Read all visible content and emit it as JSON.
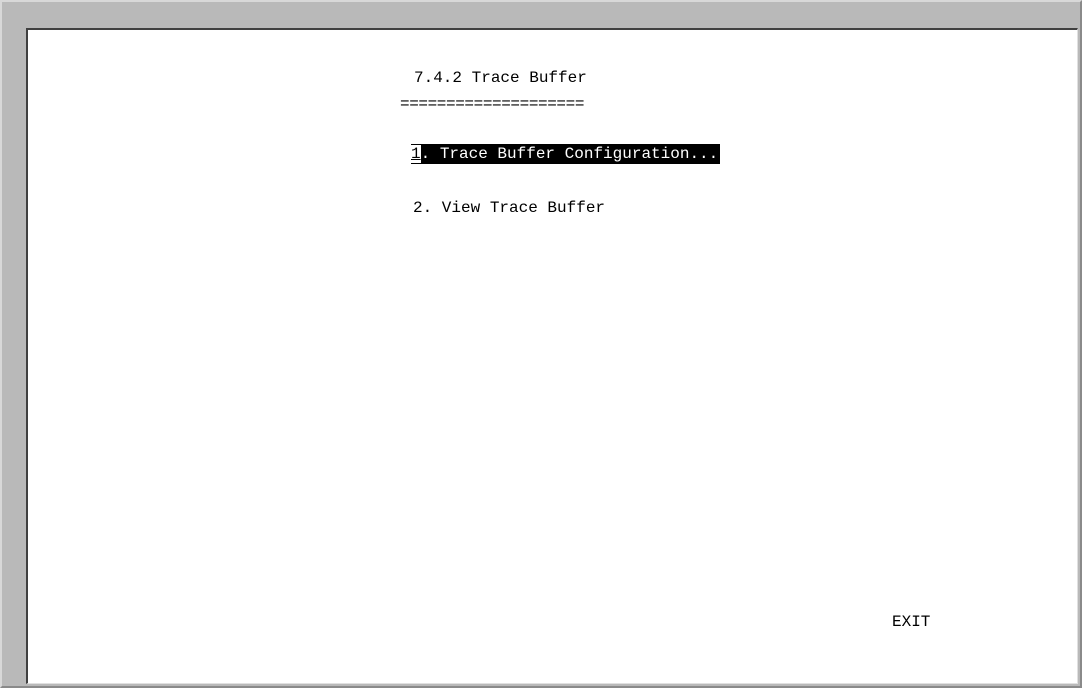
{
  "screen": {
    "title": "7.4.2 Trace Buffer",
    "title_underline": "====================",
    "menu": [
      {
        "key": "1",
        "label": ". Trace Buffer Configuration..."
      },
      {
        "key": "",
        "label": "2. View Trace Buffer"
      }
    ],
    "exit_label": "EXIT"
  },
  "colors": {
    "background": "#ffffff",
    "text": "#000000",
    "highlight_bg": "#000000",
    "highlight_text": "#ffffff",
    "frame": "#c0c0c0"
  }
}
